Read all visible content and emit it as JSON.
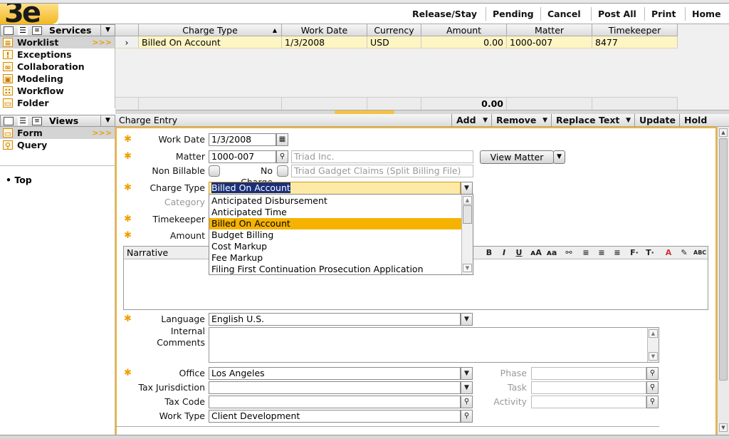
{
  "topbar": {
    "buttons": [
      "Release/Stay",
      "Pending",
      "Cancel",
      "Post All",
      "Print",
      "Home"
    ]
  },
  "nav": {
    "title": "Services",
    "items": [
      {
        "label": "Worklist",
        "icon": "worklist-icon",
        "selected": true
      },
      {
        "label": "Exceptions",
        "icon": "warning-icon"
      },
      {
        "label": "Collaboration",
        "icon": "collaboration-icon"
      },
      {
        "label": "Modeling",
        "icon": "modeling-icon"
      },
      {
        "label": "Workflow",
        "icon": "workflow-icon"
      },
      {
        "label": "Folder",
        "icon": "folder-icon"
      }
    ]
  },
  "views": {
    "title": "Views",
    "items": [
      {
        "label": "Form",
        "icon": "form-icon",
        "selected": true
      },
      {
        "label": "Query",
        "icon": "search-icon"
      }
    ],
    "top_link": "Top"
  },
  "grid": {
    "columns": [
      "Charge Type",
      "Work Date",
      "Currency",
      "Amount",
      "Matter",
      "Timekeeper"
    ],
    "rows": [
      [
        "Billed On Account",
        "1/3/2008",
        "USD",
        "0.00",
        "1000-007",
        "8477"
      ]
    ],
    "total_amount": "0.00"
  },
  "form_toolbar": {
    "title": "Charge Entry",
    "buttons": [
      "Add",
      "Remove",
      "Replace Text",
      "Update",
      "Hold"
    ]
  },
  "form": {
    "work_date_label": "Work Date",
    "work_date": "1/3/2008",
    "matter_label": "Matter",
    "matter": "1000-007",
    "matter_client": "Triad Inc.",
    "view_matter_label": "View Matter",
    "non_billable_label": "Non Billable",
    "no_charge_label": "No Charge",
    "matter_description": "Triad Gadget Claims (Split Billing File)",
    "charge_type_label": "Charge Type",
    "charge_type": "Billed On Account",
    "category_label": "Category",
    "timekeeper_label": "Timekeeper",
    "amount_label": "Amount",
    "narrative_label": "Narrative",
    "language_label": "Language",
    "language": "English U.S.",
    "internal_comments_label": "Internal Comments",
    "office_label": "Office",
    "office": "Los Angeles",
    "tax_jurisdiction_label": "Tax Jurisdiction",
    "tax_code_label": "Tax Code",
    "work_type_label": "Work Type",
    "work_type": "Client Development",
    "phase_label": "Phase",
    "task_label": "Task",
    "activity_label": "Activity"
  },
  "charge_type_options": [
    "Anticipated Disbursement",
    "Anticipated Time",
    "Billed On Account",
    "Budget Billing",
    "Cost Markup",
    "Fee Markup",
    "Filing First Continuation Prosecution Application"
  ],
  "charge_type_selected_index": 2,
  "colors": {
    "accent": "#f4b32b",
    "selected_row": "#fef5c4",
    "dropdown_selected": "#f5b300"
  }
}
